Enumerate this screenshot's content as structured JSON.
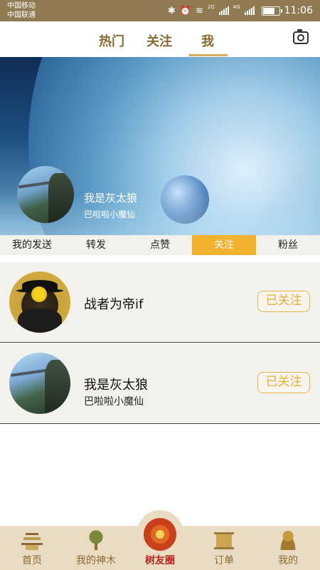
{
  "status_bar": {
    "carrier1": "中国移动",
    "carrier2": "中国联通",
    "network1": "2G",
    "network2": "4G",
    "time": "11:06"
  },
  "top_nav": {
    "tabs": [
      {
        "label": "热门"
      },
      {
        "label": "关注"
      },
      {
        "label": "我"
      }
    ],
    "active": "我",
    "camera_icon": "camera-icon",
    "accent_color": "#8a6a32",
    "underline_color": "#d8ad5a"
  },
  "profile": {
    "name": "我是灰太狼",
    "subtitle": "巴啦啦小魔仙"
  },
  "sub_tabs": [
    {
      "label": "我的发送"
    },
    {
      "label": "转发"
    },
    {
      "label": "点赞"
    },
    {
      "label": "关注"
    },
    {
      "label": "粉丝"
    }
  ],
  "sub_tab_active": "关注",
  "sub_tab_active_color": "#f2b230",
  "follow_list": [
    {
      "name": "战者为帝if",
      "subtitle": "",
      "button": "已关注"
    },
    {
      "name": "我是灰太狼",
      "subtitle": "巴啦啦小魔仙",
      "button": "已关注"
    }
  ],
  "bottom_nav": {
    "items": [
      {
        "label": "首页",
        "icon": "temple-icon"
      },
      {
        "label": "我的神木",
        "icon": "tree-icon"
      },
      {
        "label": "树友圈",
        "icon": "circle-emblem-icon"
      },
      {
        "label": "订单",
        "icon": "scroll-icon"
      },
      {
        "label": "我的",
        "icon": "person-icon"
      }
    ],
    "active": "树友圈",
    "active_color": "#b7261c"
  }
}
